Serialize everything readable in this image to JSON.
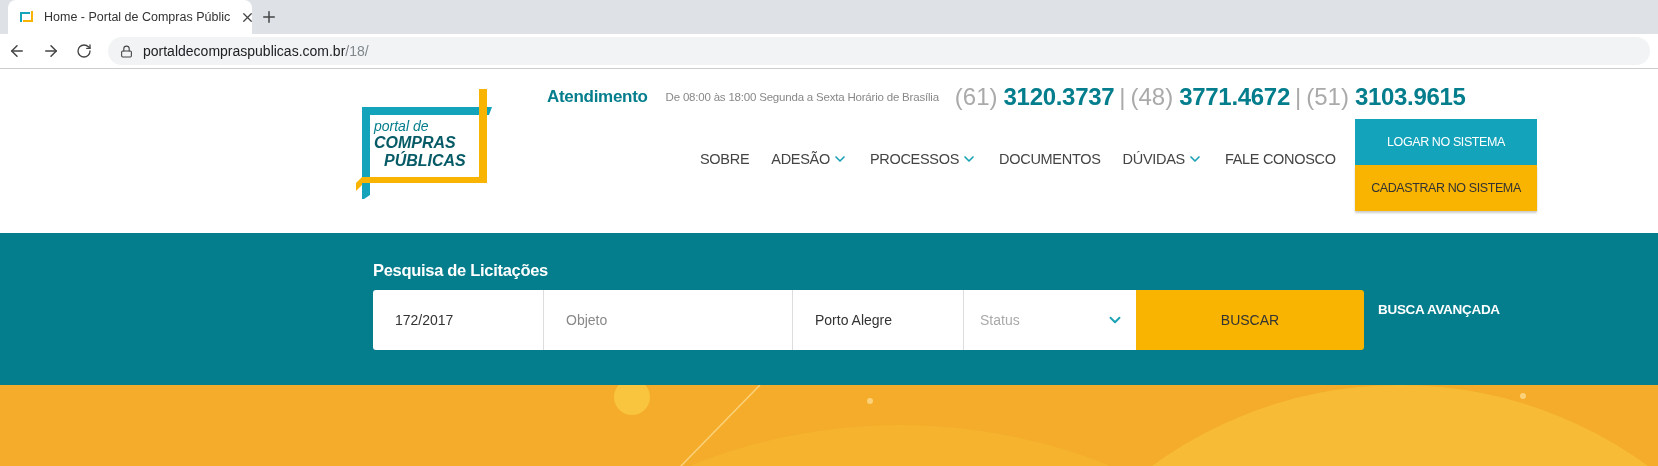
{
  "browser": {
    "tab": {
      "title": "Home - Portal de Compras Públic",
      "selected": true
    },
    "url_host": "portaldecompraspublicas.com.br",
    "url_path": "/18/"
  },
  "logo": {
    "line_1": "portal de",
    "line_2": "COMPRAS",
    "line_3": "PÚBLICAS"
  },
  "contact": {
    "label": "Atendimento",
    "hours": "De 08:00 às 18:00 Segunda a Sexta Horário de Brasília",
    "phones": [
      {
        "area": "(61)",
        "number": "3120.3737"
      },
      {
        "separator": "|",
        "area": "(48)",
        "number": "3771.4672"
      },
      {
        "separator": "|",
        "area": "(51)",
        "number": "3103.9615"
      }
    ]
  },
  "nav": [
    {
      "label": "SOBRE",
      "dropdown": false
    },
    {
      "label": "ADESÃO",
      "dropdown": true
    },
    {
      "label": "PROCESSOS",
      "dropdown": true
    },
    {
      "label": "DOCUMENTOS",
      "dropdown": false
    },
    {
      "label": "DÚVIDAS",
      "dropdown": true
    },
    {
      "label": "FALE CONOSCO",
      "dropdown": false
    }
  ],
  "account_buttons": [
    {
      "label": "LOGAR NO SISTEMA",
      "kind": "primary"
    },
    {
      "label": "CADASTRAR NO SISTEMA",
      "kind": "secondary"
    }
  ],
  "search": {
    "title": "Pesquisa de Licitações",
    "fields": [
      {
        "kind": "input",
        "value": "172/2017"
      },
      {
        "kind": "input",
        "placeholder": "Objeto"
      },
      {
        "kind": "input",
        "value": "Porto Alegre"
      },
      {
        "kind": "select",
        "placeholder": "Status"
      }
    ],
    "submit": "BUSCAR",
    "advanced": "BUSCA AVANÇADA"
  }
}
